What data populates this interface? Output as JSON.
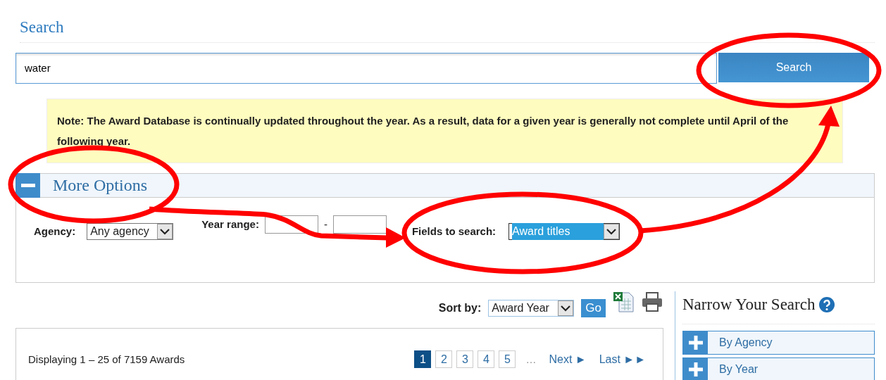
{
  "page": {
    "title": "Search"
  },
  "search": {
    "value": "water",
    "button": "Search"
  },
  "note": "Note: The Award Database is continually updated throughout the year. As a result, data for a given year is generally not complete until April of the following year.",
  "more_options": {
    "title": "More Options",
    "expanded": true,
    "agency": {
      "label": "Agency:",
      "value": "Any agency"
    },
    "year_range": {
      "label": "Year range:",
      "separator": "-"
    },
    "fields_to_search": {
      "label": "Fields to search:",
      "value": "Award titles",
      "focused": true
    }
  },
  "sort": {
    "label": "Sort by:",
    "value": "Award Year",
    "button": "Go"
  },
  "results": {
    "summary": "Displaying 1 – 25 of 7159 Awards",
    "pages": [
      {
        "label": "1",
        "selected": true
      },
      {
        "label": "2",
        "selected": false
      },
      {
        "label": "3",
        "selected": false
      },
      {
        "label": "4",
        "selected": false
      },
      {
        "label": "5",
        "selected": false
      }
    ],
    "ellipsis": "…",
    "next": "Next ►",
    "last": "Last ►►"
  },
  "narrow": {
    "title": "Narrow Your Search",
    "facets": [
      {
        "label": "By Agency",
        "expanded": false
      },
      {
        "label": "By Year",
        "expanded": false
      }
    ]
  },
  "annotations": [
    {
      "kind": "ellipse"
    },
    {
      "kind": "ellipse"
    },
    {
      "kind": "ellipse"
    },
    {
      "kind": "arrow"
    },
    {
      "kind": "arrow"
    }
  ]
}
